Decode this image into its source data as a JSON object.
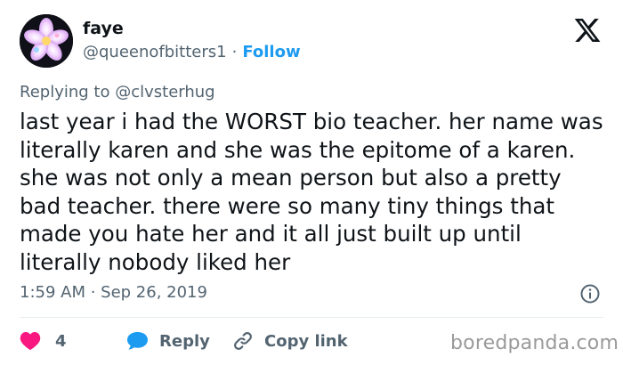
{
  "author": {
    "name": "faye",
    "handle": "@queenofbitters1",
    "separator": "·",
    "follow_label": "Follow"
  },
  "reply_context": {
    "prefix": "Replying to",
    "mention": "@clvsterhug"
  },
  "tweet": {
    "text": "last year i had the WORST bio teacher. her name was literally karen and she was the epitome of a karen. she was not only a mean person but also a pretty bad teacher. there were so many tiny things that made you hate her and it all just built up until literally nobody liked her",
    "timestamp": "1:59 AM · Sep 26, 2019"
  },
  "actions": {
    "like_count": "4",
    "reply_label": "Reply",
    "copy_label": "Copy link"
  },
  "watermark": "boredpanda.com",
  "icons": {
    "logo": "x-logo-icon",
    "info": "info-icon",
    "like": "heart-icon",
    "reply": "speech-bubble-icon",
    "copy": "link-icon"
  },
  "colors": {
    "accent": "#1d9bf0",
    "like": "#f91880",
    "text": "#0f1419",
    "muted": "#536471"
  }
}
